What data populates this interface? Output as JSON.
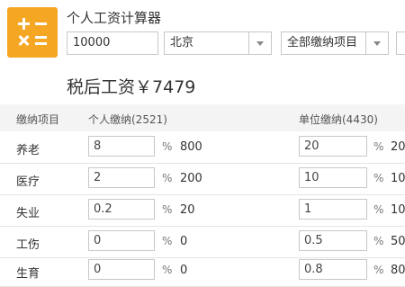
{
  "app": {
    "icon_name": "calculator-icon",
    "icon_color": "#f5a623",
    "title": "个人工资计算器"
  },
  "controls": {
    "salary_value": "10000",
    "city_value": "北京",
    "items_value": "全部缴纳项目"
  },
  "result": {
    "label": "税后工资",
    "currency": "￥",
    "value": "7479"
  },
  "table": {
    "headers": {
      "item": "缴纳项目",
      "personal": "个人缴纳(2521)",
      "employer": "单位缴纳(4430)"
    },
    "percent_sign": "%",
    "rows": [
      {
        "label": "养老",
        "personal_rate": "8",
        "personal_amount": "800",
        "employer_rate": "20",
        "employer_amount": "20"
      },
      {
        "label": "医疗",
        "personal_rate": "2",
        "personal_amount": "200",
        "employer_rate": "10",
        "employer_amount": "10"
      },
      {
        "label": "失业",
        "personal_rate": "0.2",
        "personal_amount": "20",
        "employer_rate": "1",
        "employer_amount": "10"
      },
      {
        "label": "工伤",
        "personal_rate": "0",
        "personal_amount": "0",
        "employer_rate": "0.5",
        "employer_amount": "50"
      },
      {
        "label": "生育",
        "personal_rate": "0",
        "personal_amount": "0",
        "employer_rate": "0.8",
        "employer_amount": "80"
      }
    ]
  }
}
